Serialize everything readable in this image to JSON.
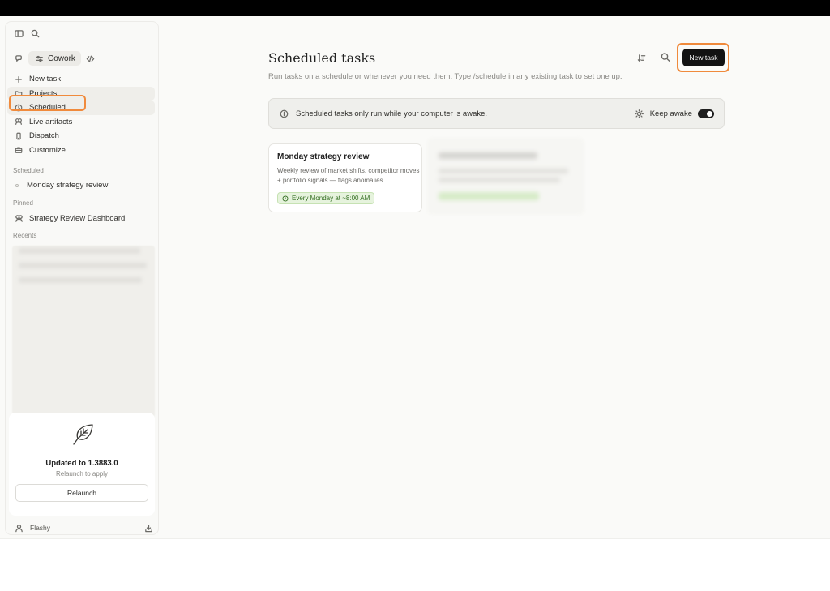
{
  "app": {
    "mode_label": "Cowork",
    "accent_color": "#f08a3c"
  },
  "sidebar": {
    "nav": [
      {
        "label": "New task",
        "icon": "plus-icon"
      },
      {
        "label": "Projects",
        "icon": "folder-icon"
      },
      {
        "label": "Scheduled",
        "icon": "clock-icon"
      },
      {
        "label": "Live artifacts",
        "icon": "artifact-icon"
      },
      {
        "label": "Dispatch",
        "icon": "phone-icon"
      },
      {
        "label": "Customize",
        "icon": "briefcase-icon"
      }
    ],
    "scheduled_label": "Scheduled",
    "scheduled_items": [
      "Monday strategy review"
    ],
    "pinned_label": "Pinned",
    "pinned_items": [
      "Strategy Review Dashboard"
    ],
    "recents_label": "Recents",
    "update": {
      "title": "Updated to 1.3883.0",
      "subtitle": "Relaunch to apply",
      "button": "Relaunch"
    },
    "user": "Flashy"
  },
  "main": {
    "title": "Scheduled tasks",
    "subtitle": "Run tasks on a schedule or whenever you need them. Type /schedule in any existing task to set one up.",
    "new_task_button": "New task",
    "info": {
      "message": "Scheduled tasks only run while your computer is awake.",
      "keep_awake_label": "Keep awake",
      "keep_awake_on": true
    },
    "tasks": [
      {
        "title": "Monday strategy review",
        "description": "Weekly review of market shifts, competitor moves + portfolio signals — flags anomalies...",
        "schedule": "Every Monday at ~8:00 AM"
      }
    ]
  }
}
